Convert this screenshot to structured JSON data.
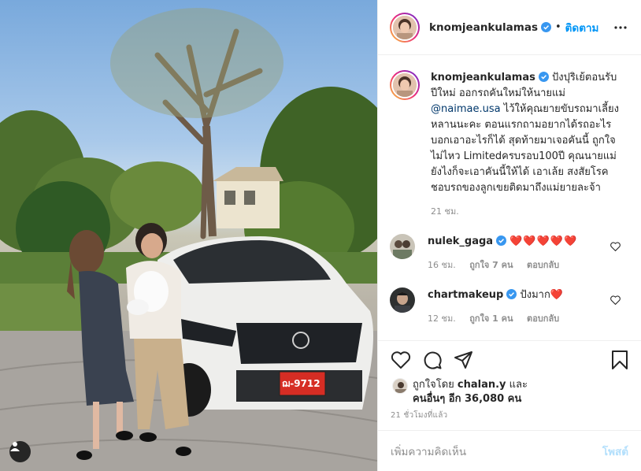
{
  "post": {
    "username": "knomjeankulamas",
    "follow_label": "ติดตาม",
    "dot": "•"
  },
  "caption": {
    "username": "knomjeankulamas",
    "text_before": "ปังปุริเย้ตอนรับปีใหม่ ออกรถคันใหม่ให้นายแม่ ",
    "mention": "@naimae.usa",
    "text_after": " ไว้ให้คุณยายขับรถมาเลี้ยงหลานนะคะ ตอนแรกถามอยากได้รถอะไร บอกเอาอะไรก็ได้ สุดท้ายมาเจอคันนี้ ถูกใจไม่ไหว Limitedครบรอบ100ปี คุณนายแม่ยังไงก็จะเอาคันนี้ให้ได้ เอาเล้ย สงสัยโรคชอบรถของลูกเขยติดมาถึงแม่ยายละจ้า",
    "time": "21 ชม."
  },
  "comments": [
    {
      "username": "nulek_gaga",
      "text": "❤️❤️❤️❤️❤️",
      "time": "16 ชม.",
      "likes": "ถูกใจ 7 คน",
      "reply": "ตอบกลับ"
    },
    {
      "username": "chartmakeup",
      "text": "ปังมาก❤️",
      "time": "12 ชม.",
      "likes": "ถูกใจ 1 คน",
      "reply": "ตอบกลับ"
    }
  ],
  "likes": {
    "prefix": "ถูกใจโดย ",
    "user": "chalan.y",
    "middle": " และ",
    "others": "คนอื่นๆ อีก 36,080 คน"
  },
  "timestamp": "21 ชั่วโมงที่แล้ว",
  "add_comment": {
    "placeholder": "เพิ่มความคิดเห็น",
    "post_label": "โพสต์"
  },
  "photo": {
    "license_plate": "ฌ-9712"
  },
  "colors": {
    "accent": "#0095f6",
    "verified": "#3897f0",
    "heart": "#ed4956",
    "muted": "#8e8e8e"
  },
  "icons": [
    "heart-icon",
    "comment-icon",
    "share-icon",
    "bookmark-icon",
    "more-icon",
    "user-tag-icon",
    "verified-icon"
  ]
}
